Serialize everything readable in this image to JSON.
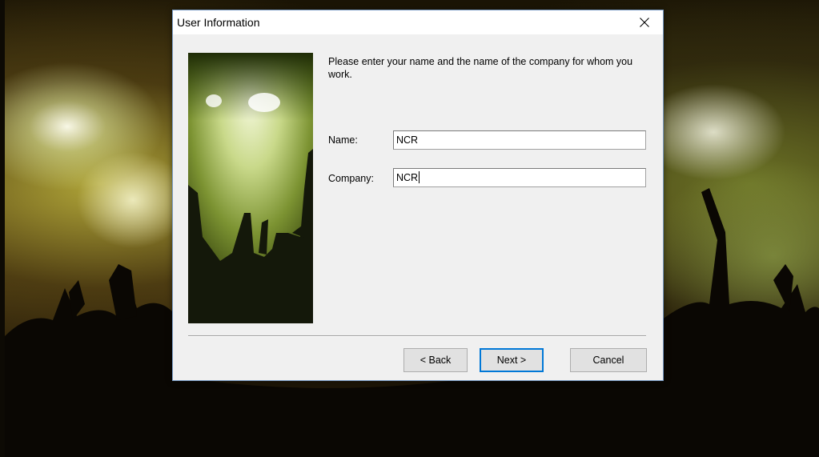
{
  "dialog": {
    "title": "User Information",
    "prompt": "Please enter your name and the name of the company for whom you work.",
    "name_label": "Name:",
    "name_value": "NCR",
    "company_label": "Company:",
    "company_value": "NCR",
    "buttons": {
      "back": "< Back",
      "next": "Next >",
      "cancel": "Cancel"
    }
  },
  "colors": {
    "dialog_bg": "#f0f0f0",
    "title_bg": "#ffffff",
    "default_button_border": "#0078d7"
  },
  "icons": {
    "close": "close-icon"
  }
}
